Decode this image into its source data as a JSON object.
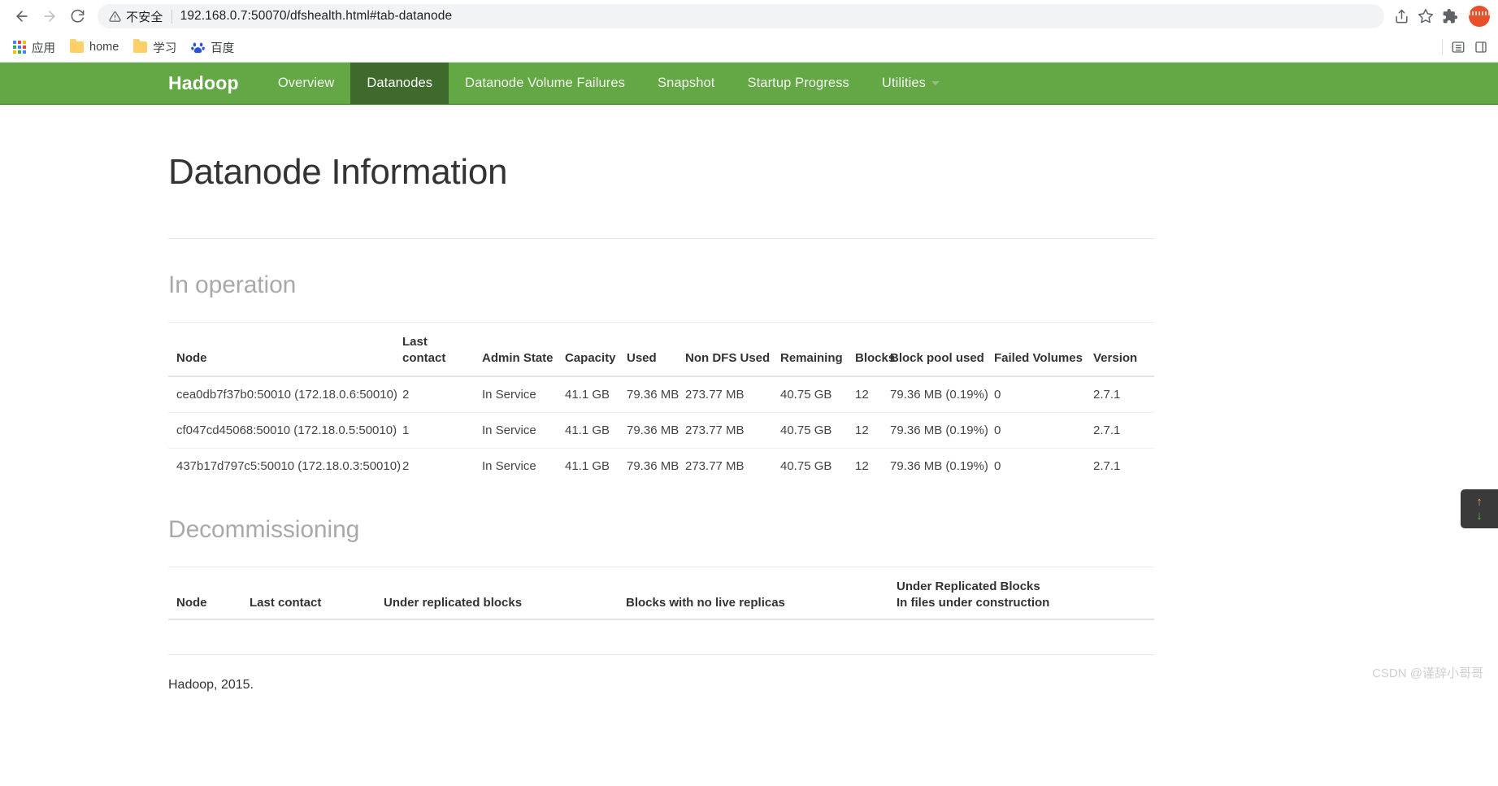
{
  "browser": {
    "back_icon": "back-arrow-icon",
    "forward_icon": "forward-arrow-icon",
    "reload_icon": "reload-icon",
    "security_warning": "不安全",
    "url": "192.168.0.7:50070/dfshealth.html#tab-datanode",
    "share_icon": "share-icon",
    "bookmark_icon": "star-icon",
    "extensions_icon": "puzzle-piece-icon",
    "profile_icon": "profile-avatar",
    "bookmarks": [
      {
        "label": "应用",
        "icon": "apps-grid-icon"
      },
      {
        "label": "home",
        "icon": "folder-icon"
      },
      {
        "label": "学习",
        "icon": "folder-icon"
      },
      {
        "label": "百度",
        "icon": "baidu-paw-icon"
      }
    ],
    "bookmarks_right": [
      {
        "icon": "reading-list-icon"
      },
      {
        "icon": "sidebar-icon"
      }
    ]
  },
  "navbar": {
    "brand": "Hadoop",
    "accent_color": "#63a844",
    "active_color": "#3e6b2b",
    "tabs": [
      {
        "label": "Overview",
        "active": false
      },
      {
        "label": "Datanodes",
        "active": true
      },
      {
        "label": "Datanode Volume Failures",
        "active": false
      },
      {
        "label": "Snapshot",
        "active": false
      },
      {
        "label": "Startup Progress",
        "active": false
      },
      {
        "label": "Utilities",
        "active": false,
        "caret": true
      }
    ]
  },
  "main": {
    "page_title": "Datanode Information",
    "in_operation": {
      "heading": "In operation",
      "columns": [
        "Node",
        "Last contact",
        "Admin State",
        "Capacity",
        "Used",
        "Non DFS Used",
        "Remaining",
        "Blocks",
        "Block pool used",
        "Failed Volumes",
        "Version"
      ],
      "rows": [
        {
          "node": "cea0db7f37b0:50010 (172.18.0.6:50010)",
          "last_contact": "2",
          "admin_state": "In Service",
          "capacity": "41.1 GB",
          "used": "79.36 MB",
          "non_dfs_used": "273.77 MB",
          "remaining": "40.75 GB",
          "blocks": "12",
          "block_pool_used": "79.36 MB (0.19%)",
          "failed_volumes": "0",
          "version": "2.7.1"
        },
        {
          "node": "cf047cd45068:50010 (172.18.0.5:50010)",
          "last_contact": "1",
          "admin_state": "In Service",
          "capacity": "41.1 GB",
          "used": "79.36 MB",
          "non_dfs_used": "273.77 MB",
          "remaining": "40.75 GB",
          "blocks": "12",
          "block_pool_used": "79.36 MB (0.19%)",
          "failed_volumes": "0",
          "version": "2.7.1"
        },
        {
          "node": "437b17d797c5:50010 (172.18.0.3:50010)",
          "last_contact": "2",
          "admin_state": "In Service",
          "capacity": "41.1 GB",
          "used": "79.36 MB",
          "non_dfs_used": "273.77 MB",
          "remaining": "40.75 GB",
          "blocks": "12",
          "block_pool_used": "79.36 MB (0.19%)",
          "failed_volumes": "0",
          "version": "2.7.1"
        }
      ]
    },
    "decommissioning": {
      "heading": "Decommissioning",
      "columns": [
        "Node",
        "Last contact",
        "Under replicated blocks",
        "Blocks with no live replicas"
      ],
      "last_column_line1": "Under Replicated Blocks",
      "last_column_line2": "In files under construction",
      "rows": []
    },
    "footer": "Hadoop, 2015."
  },
  "overlay": {
    "scroll_up_icon": "arrow-up-icon",
    "scroll_down_icon": "arrow-down-icon",
    "scroll_up_glyph": "↑",
    "scroll_down_glyph": "↓",
    "watermark": "CSDN @谨辞小哥哥"
  }
}
